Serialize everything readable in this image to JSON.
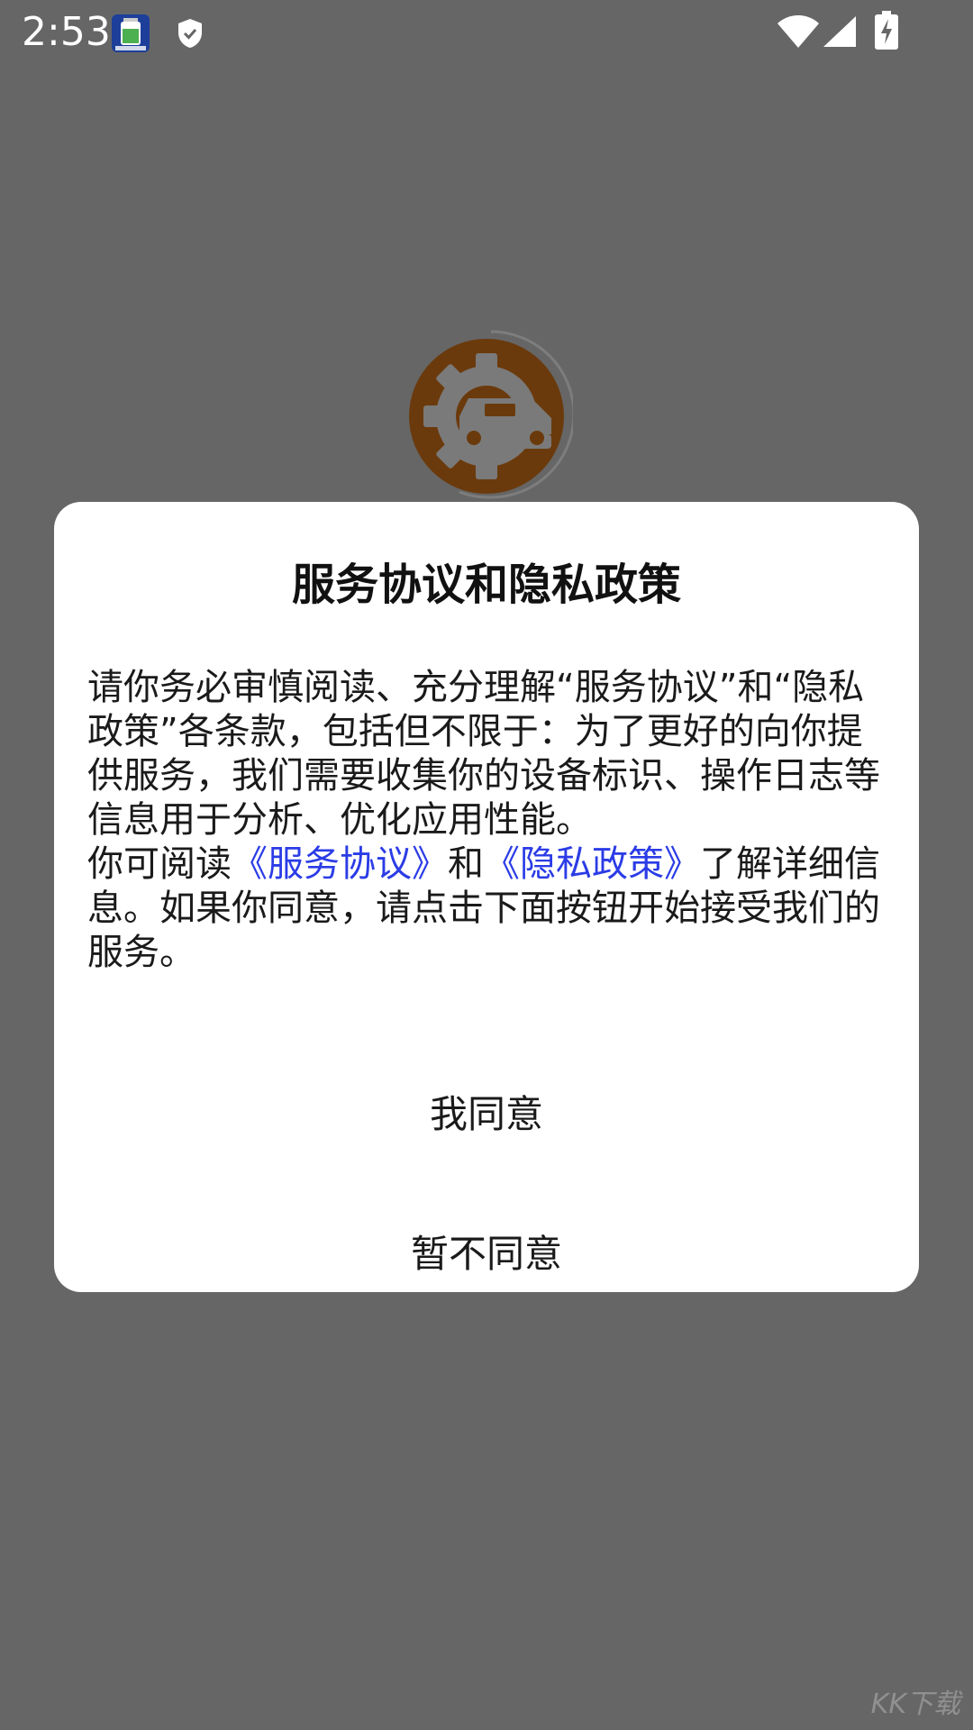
{
  "status_bar": {
    "time": "2:53",
    "icons": [
      "app-notification-icon",
      "shield-icon",
      "wifi-icon",
      "cell-signal-icon",
      "battery-charging-icon"
    ]
  },
  "splash": {
    "logo_icon": "gear-car-icon",
    "colors": {
      "logo_fill": "#6b3a0c",
      "gear": "#7a7a7a"
    }
  },
  "dialog": {
    "title": "服务协议和隐私政策",
    "body_para1": "请你务必审慎阅读、充分理解“服务协议”和“隐私政策”各条款，包括但不限于：为了更好的向你提供服务，我们需要收集你的设备标识、操作日志等信息用于分析、优化应用性能。",
    "body_para2_prefix": "你可阅读",
    "link_service": "《服务协议》",
    "body_para2_and": "和",
    "link_privacy": "《隐私政策》",
    "body_para2_suffix": "了解详细信息。如果你同意，请点击下面按钮开始接受我们的服务。",
    "agree_label": "我同意",
    "disagree_label": "暂不同意"
  },
  "watermark": "KK下载",
  "colors": {
    "overlay": "#666666",
    "dialog_bg": "#ffffff",
    "link": "#2b3ce6"
  }
}
